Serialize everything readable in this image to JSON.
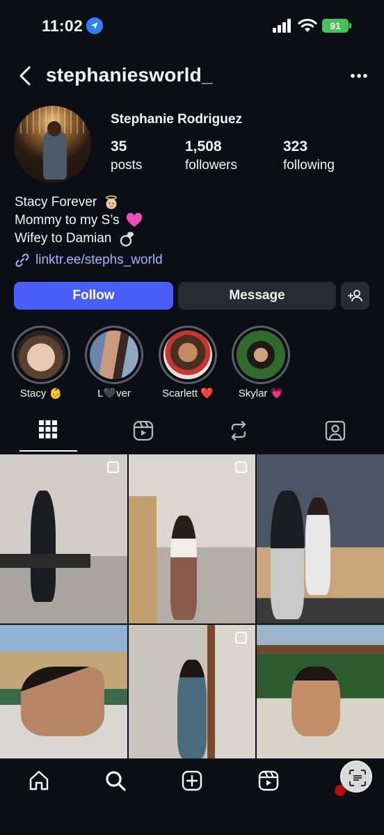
{
  "status_bar": {
    "time": "11:02",
    "battery": "91"
  },
  "header": {
    "username": "stephaniesworld_"
  },
  "profile": {
    "full_name": "Stephanie Rodriguez",
    "stats": [
      {
        "value": "35",
        "label": "posts"
      },
      {
        "value": "1,508",
        "label": "followers"
      },
      {
        "value": "323",
        "label": "following"
      }
    ],
    "bio": [
      {
        "text": "Stacy Forever",
        "emoji": "baby-angel"
      },
      {
        "text": "Mommy to my S’s",
        "emoji": "pink-heart"
      },
      {
        "text": "Wifey to Damian",
        "emoji": "ring"
      }
    ],
    "link": "linktr.ee/stephs_world"
  },
  "actions": {
    "follow": "Follow",
    "message": "Message"
  },
  "highlights": [
    {
      "label": "Stacy 👶"
    },
    {
      "label": "L🖤ver"
    },
    {
      "label": "Scarlett ❤️"
    },
    {
      "label": "Skylar 💗"
    }
  ],
  "tabs": [
    "grid-icon",
    "reels-icon",
    "reposts-icon",
    "tagged-icon"
  ],
  "bottom_nav": [
    "home-icon",
    "search-icon",
    "create-icon",
    "reels-icon",
    "profile-icon"
  ],
  "colors": {
    "background": "#0b0e14",
    "follow_button": "#4a5df9",
    "secondary_button": "#262a33",
    "link": "#a3b3ff",
    "battery": "#45c35a"
  }
}
